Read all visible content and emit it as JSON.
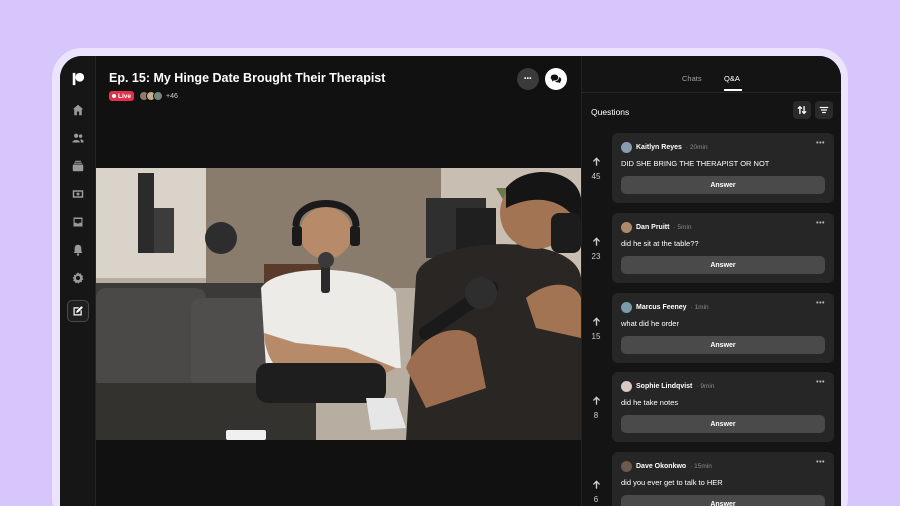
{
  "episode": {
    "title": "Ep. 15: My Hinge Date Brought Their Therapist",
    "live_label": "Live",
    "listener_extra": "+46"
  },
  "header_buttons": {
    "more_label": "•••"
  },
  "panel": {
    "tabs": [
      {
        "label": "Chats"
      },
      {
        "label": "Q&A"
      }
    ],
    "heading": "Questions",
    "answer_label": "Answer",
    "more_label": "•••",
    "questions": [
      {
        "votes": "45",
        "name": "Kaitlyn Reyes",
        "time": "· 20min",
        "text": "DID SHE BRING THE THERAPIST OR NOT",
        "avatar_color": "#8a9bb0"
      },
      {
        "votes": "23",
        "name": "Dan Pruitt",
        "time": "· 5min",
        "text": "did he sit at the table??",
        "avatar_color": "#b0896a"
      },
      {
        "votes": "15",
        "name": "Marcus Feeney",
        "time": "· 1min",
        "text": "what did he order",
        "avatar_color": "#7c9aa8"
      },
      {
        "votes": "8",
        "name": "Sophie Lindqvist",
        "time": "· 9min",
        "text": "did he take notes",
        "avatar_color": "#d8c9c2"
      },
      {
        "votes": "6",
        "name": "Dave Okonkwo",
        "time": "· 15min",
        "text": "did you ever get to talk to HER",
        "avatar_color": "#6b5a4d"
      }
    ]
  },
  "colors": {
    "accent_live": "#e0324b",
    "background": "#d6c6fb",
    "screen": "#0f0f0f"
  }
}
